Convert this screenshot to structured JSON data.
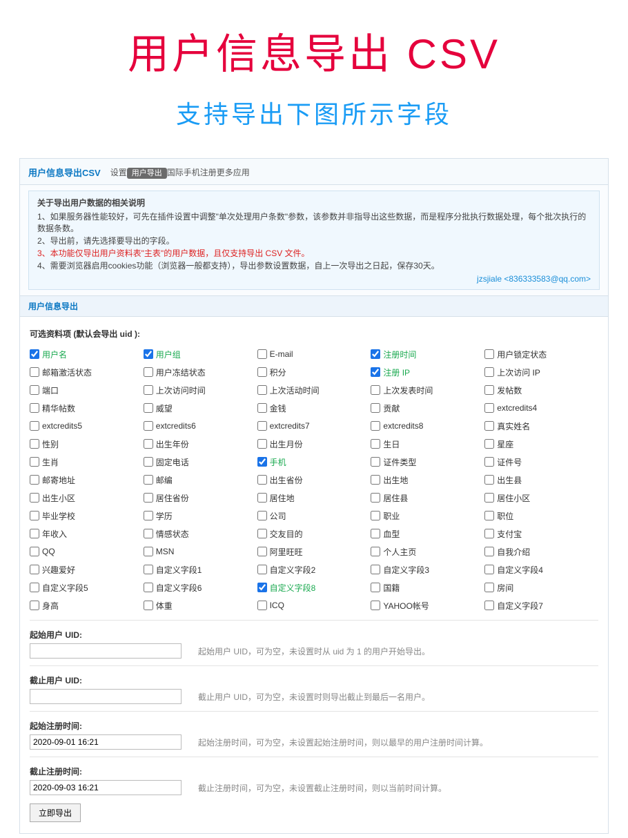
{
  "hero": {
    "title": "用户信息导出 CSV",
    "sub": "支持导出下图所示字段"
  },
  "tabs": {
    "title": "用户信息导出CSV",
    "items": [
      "设置",
      "用户导出",
      "国际手机注册",
      "更多应用"
    ],
    "active": "用户导出"
  },
  "info": {
    "title": "关于导出用户数据的相关说明",
    "lines": [
      "1、如果服务器性能较好，可先在插件设置中调整\"单次处理用户条数\"参数，该参数并非指导出这些数据，而是程序分批执行数据处理，每个批次执行的数据条数。",
      "2、导出前，请先选择要导出的字段。",
      "3、本功能仅导出用户资料表\"主表\"的用户数据，且仅支持导出 CSV 文件。",
      "4、需要浏览器启用cookies功能（浏览器一般都支持），导出参数设置数据，自上一次导出之日起，保存30天。"
    ],
    "red_line_index": 2,
    "author": "jzsjiale <836333583@qq.com>"
  },
  "section_header": "用户信息导出",
  "fields_header": "可选资料项 (默认会导出 uid ):",
  "fields": [
    {
      "label": "用户名",
      "checked": true,
      "green": true
    },
    {
      "label": "用户组",
      "checked": true,
      "green": true
    },
    {
      "label": "E-mail",
      "checked": false
    },
    {
      "label": "注册时间",
      "checked": true,
      "green": true
    },
    {
      "label": "用户锁定状态",
      "checked": false
    },
    {
      "label": "邮箱激活状态",
      "checked": false
    },
    {
      "label": "用户冻结状态",
      "checked": false
    },
    {
      "label": "积分",
      "checked": false
    },
    {
      "label": "注册 IP",
      "checked": true,
      "green": true
    },
    {
      "label": "上次访问 IP",
      "checked": false
    },
    {
      "label": "端口",
      "checked": false
    },
    {
      "label": "上次访问时间",
      "checked": false
    },
    {
      "label": "上次活动时间",
      "checked": false
    },
    {
      "label": "上次发表时间",
      "checked": false
    },
    {
      "label": "发帖数",
      "checked": false
    },
    {
      "label": "精华帖数",
      "checked": false
    },
    {
      "label": "威望",
      "checked": false
    },
    {
      "label": "金钱",
      "checked": false
    },
    {
      "label": "贡献",
      "checked": false
    },
    {
      "label": "extcredits4",
      "checked": false
    },
    {
      "label": "extcredits5",
      "checked": false
    },
    {
      "label": "extcredits6",
      "checked": false
    },
    {
      "label": "extcredits7",
      "checked": false
    },
    {
      "label": "extcredits8",
      "checked": false
    },
    {
      "label": "真实姓名",
      "checked": false
    },
    {
      "label": "性别",
      "checked": false
    },
    {
      "label": "出生年份",
      "checked": false
    },
    {
      "label": "出生月份",
      "checked": false
    },
    {
      "label": "生日",
      "checked": false
    },
    {
      "label": "星座",
      "checked": false
    },
    {
      "label": "生肖",
      "checked": false
    },
    {
      "label": "固定电话",
      "checked": false
    },
    {
      "label": "手机",
      "checked": true,
      "green": true
    },
    {
      "label": "证件类型",
      "checked": false
    },
    {
      "label": "证件号",
      "checked": false
    },
    {
      "label": "邮寄地址",
      "checked": false
    },
    {
      "label": "邮编",
      "checked": false
    },
    {
      "label": "出生省份",
      "checked": false
    },
    {
      "label": "出生地",
      "checked": false
    },
    {
      "label": "出生县",
      "checked": false
    },
    {
      "label": "出生小区",
      "checked": false
    },
    {
      "label": "居住省份",
      "checked": false
    },
    {
      "label": "居住地",
      "checked": false
    },
    {
      "label": "居住县",
      "checked": false
    },
    {
      "label": "居住小区",
      "checked": false
    },
    {
      "label": "毕业学校",
      "checked": false
    },
    {
      "label": "学历",
      "checked": false
    },
    {
      "label": "公司",
      "checked": false
    },
    {
      "label": "职业",
      "checked": false
    },
    {
      "label": "职位",
      "checked": false
    },
    {
      "label": "年收入",
      "checked": false
    },
    {
      "label": "情感状态",
      "checked": false
    },
    {
      "label": "交友目的",
      "checked": false
    },
    {
      "label": "血型",
      "checked": false
    },
    {
      "label": "支付宝",
      "checked": false
    },
    {
      "label": "QQ",
      "checked": false
    },
    {
      "label": "MSN",
      "checked": false
    },
    {
      "label": "阿里旺旺",
      "checked": false
    },
    {
      "label": "个人主页",
      "checked": false
    },
    {
      "label": "自我介绍",
      "checked": false
    },
    {
      "label": "兴趣爱好",
      "checked": false
    },
    {
      "label": "自定义字段1",
      "checked": false
    },
    {
      "label": "自定义字段2",
      "checked": false
    },
    {
      "label": "自定义字段3",
      "checked": false
    },
    {
      "label": "自定义字段4",
      "checked": false
    },
    {
      "label": "自定义字段5",
      "checked": false
    },
    {
      "label": "自定义字段6",
      "checked": false
    },
    {
      "label": "自定义字段8",
      "checked": true,
      "green": true
    },
    {
      "label": "国籍",
      "checked": false
    },
    {
      "label": "房间",
      "checked": false
    },
    {
      "label": "身高",
      "checked": false
    },
    {
      "label": "体重",
      "checked": false
    },
    {
      "label": "ICQ",
      "checked": false
    },
    {
      "label": "YAHOO帐号",
      "checked": false
    },
    {
      "label": "自定义字段7",
      "checked": false
    }
  ],
  "form": {
    "start_uid": {
      "label": "起始用户 UID:",
      "value": "",
      "hint": "起始用户 UID，可为空，未设置时从 uid 为 1 的用户开始导出。"
    },
    "end_uid": {
      "label": "截止用户 UID:",
      "value": "",
      "hint": "截止用户 UID，可为空，未设置时则导出截止到最后一名用户。"
    },
    "start_time": {
      "label": "起始注册时间:",
      "value": "2020-09-01 16:21",
      "hint": "起始注册时间，可为空，未设置起始注册时间，则以最早的用户注册时间计算。"
    },
    "end_time": {
      "label": "截止注册时间:",
      "value": "2020-09-03 16:21",
      "hint": "截止注册时间，可为空，未设置截止注册时间，则以当前时间计算。"
    },
    "submit": "立即导出"
  }
}
